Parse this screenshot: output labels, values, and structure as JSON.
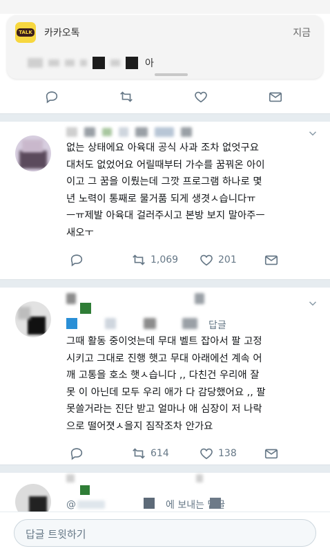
{
  "notification": {
    "app_name": "카카오톡",
    "time": "지금",
    "message_visible_tail": "아",
    "icon_label": "TALK",
    "icon_color": "#f7d73f"
  },
  "tweets": [
    {
      "lines": [
        "없는 상태에요 아육대 공식 사과 조차 없엇구요",
        "대처도 없었어요 어릴때부터 가수를 꿈꿔온 아이",
        "이고 그 꿈을 이뤘는데 그깟 프로그램 하나로 몇",
        "년 노력이 통째로 물거품 되게 생겻ㅅ습니다ㅠ",
        "ㅡㅠ제발 아육대 걸러주시고 본방 보지 말아주ㅡ",
        "새오ㅜ"
      ],
      "retweets": "1,069",
      "likes": "201"
    },
    {
      "reply_label": "답글",
      "lines": [
        "그때 활동 중이엇는데 무대 벨트 잡아서 팔 고정",
        "시키고 그대로 진행 햇고 무대 아래에선 계속 어",
        "깨 고통을 호소 햇ㅅ습니다 ,, 다친건 우리애 잘",
        "못 이 아닌데 모두 우리 애가 다 감당했어요 ,, 팔",
        "못쓸거라는 진단 받고 얼마나 애 심장이 저 나락",
        "으로 떨어졋ㅅ을지 짐작조차 안가요"
      ],
      "retweets": "614",
      "likes": "138"
    },
    {
      "reply_prefix": "@",
      "reply_label": "에 보내는 답글"
    }
  ],
  "compose": {
    "placeholder": "답글 트윗하기"
  },
  "colors": {
    "icon_gray": "#657786",
    "separator": "#e6ecf0"
  }
}
